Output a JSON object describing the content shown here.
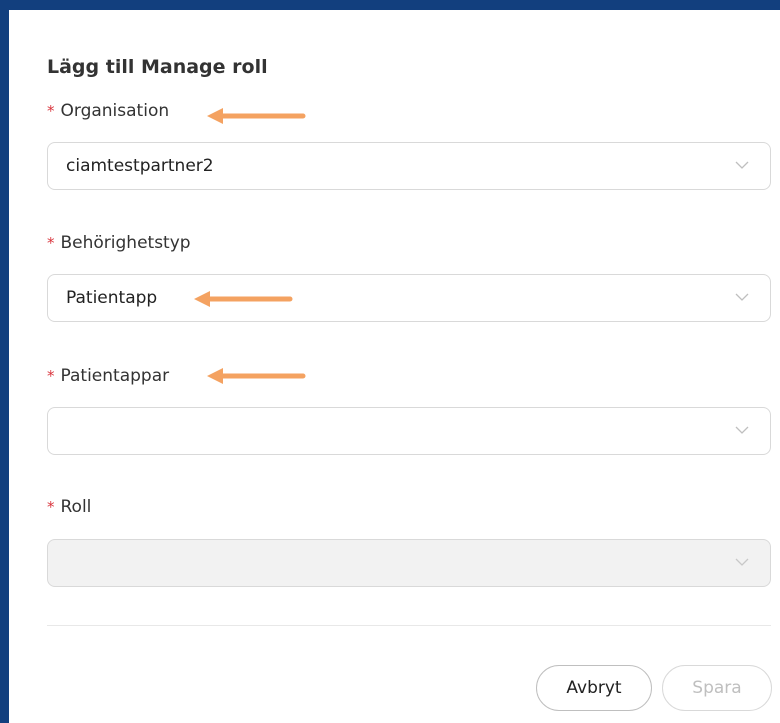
{
  "dialog": {
    "title": "Lägg till Manage roll"
  },
  "fields": {
    "organisation": {
      "label": "Organisation",
      "required_mark": "*",
      "value": "ciamtestpartner2"
    },
    "behorighetstyp": {
      "label": "Behörighetstyp",
      "required_mark": "*",
      "value": "Patientapp"
    },
    "patientappar": {
      "label": "Patientappar",
      "required_mark": "*",
      "value": ""
    },
    "roll": {
      "label": "Roll",
      "required_mark": "*",
      "value": "",
      "disabled": true
    }
  },
  "buttons": {
    "cancel_label": "Avbryt",
    "save_label": "Spara"
  },
  "colors": {
    "frame": "#123f7e",
    "required": "#d9363e",
    "annotation_arrow": "#f4a261"
  },
  "icons": {
    "select_chevron": "chevron-down-icon",
    "annotation": "arrow-left-icon"
  }
}
